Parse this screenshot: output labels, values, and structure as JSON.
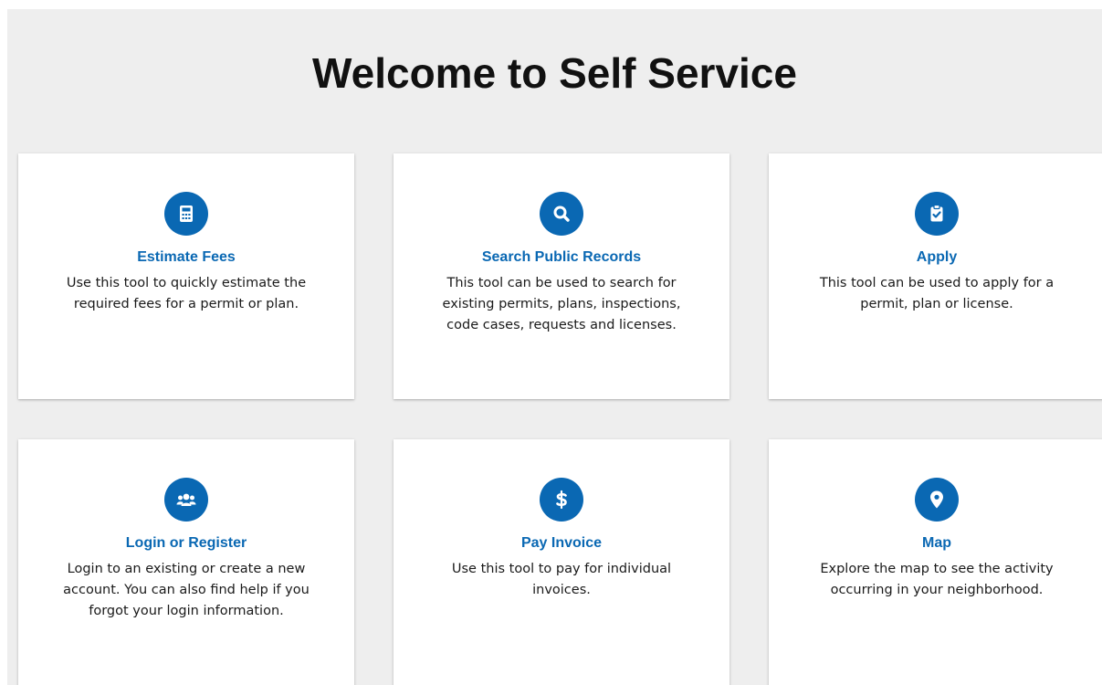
{
  "page": {
    "title": "Welcome to Self Service"
  },
  "colors": {
    "accent": "#0a68b3",
    "background": "#eeeeee",
    "card": "#ffffff"
  },
  "cards": [
    {
      "title": "Estimate Fees",
      "description": "Use this tool to quickly estimate the required fees for a permit or plan.",
      "icon": "calculator-icon"
    },
    {
      "title": "Search Public Records",
      "description": "This tool can be used to search for existing permits, plans, inspections, code cases, requests and licenses.",
      "icon": "search-icon"
    },
    {
      "title": "Apply",
      "description": "This tool can be used to apply for a permit, plan or license.",
      "icon": "clipboard-check-icon"
    },
    {
      "title": "Login or Register",
      "description": "Login to an existing or create a new account. You can also find help if you forgot your login information.",
      "icon": "users-icon"
    },
    {
      "title": "Pay Invoice",
      "description": "Use this tool to pay for individual invoices.",
      "icon": "dollar-icon"
    },
    {
      "title": "Map",
      "description": "Explore the map to see the activity occurring in your neighborhood.",
      "icon": "map-pin-icon"
    }
  ]
}
